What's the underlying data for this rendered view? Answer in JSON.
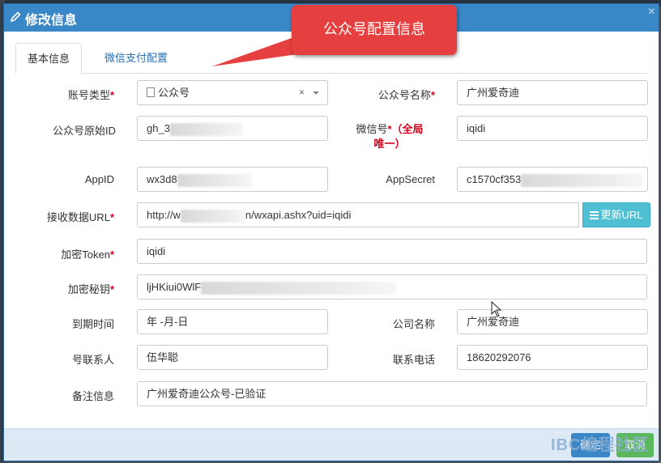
{
  "modal": {
    "title": "修改信息",
    "close": "×",
    "tabs": [
      {
        "label": "基本信息",
        "active": true
      },
      {
        "label": "微信支付配置",
        "active": false
      }
    ]
  },
  "callout": {
    "text": "公众号配置信息"
  },
  "form": {
    "account_type": {
      "label": "账号类型",
      "value": "公众号"
    },
    "account_name": {
      "label": "公众号名称",
      "value": "广州爱奇迪"
    },
    "original_id": {
      "label": "公众号原始ID",
      "value": "gh_3"
    },
    "wechat_id": {
      "label": "微信号",
      "note_line1": "（全局",
      "note_line2": "唯一）",
      "value": "iqidi"
    },
    "appid": {
      "label": "AppID",
      "value": "wx3d8"
    },
    "appsecret": {
      "label": "AppSecret",
      "value": "c1570cf353"
    },
    "receive_url": {
      "label": "接收数据URL",
      "value_prefix": "http://w",
      "value_suffix": "n/wxapi.ashx?uid=iqidi",
      "button": "更新URL"
    },
    "token": {
      "label": "加密Token",
      "value": "iqidi"
    },
    "secret_key": {
      "label": "加密秘钥",
      "value": "ljHKiui0WlF"
    },
    "expire_date": {
      "label": "到期时间",
      "value": "年 -月-日"
    },
    "company": {
      "label": "公司名称",
      "value": "广州爱奇迪"
    },
    "contact": {
      "label": "号联系人",
      "value": "伍华聪"
    },
    "phone": {
      "label": "联系电话",
      "value": "18620292076"
    },
    "remark": {
      "label": "备注信息",
      "value": "广州爱奇迪公众号-已验证"
    }
  },
  "footer": {
    "save": "确定",
    "cancel": "取消",
    "watermark": "IBC编程社区"
  },
  "colors": {
    "header": "#3a87c7",
    "callout": "#e5403f",
    "required": "#d0021b",
    "url_button": "#4fc0d3"
  }
}
